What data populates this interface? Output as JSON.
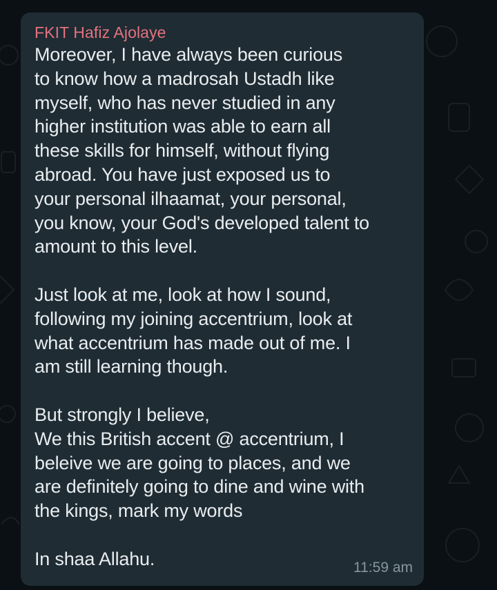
{
  "message": {
    "sender": "FKIT Hafiz Ajolaye",
    "paragraphs": [
      "Moreover, I have always been curious\nto know how a madrosah Ustadh like\nmyself, who has never studied in any\nhigher institution was able to earn all\nthese skills for himself, without flying\nabroad. You have just exposed us to\nyour  personal ilhaamat, your personal,\nyou know, your God's developed talent to\namount to this level.",
      "Just look at me, look at how I sound,\nfollowing my joining accentrium, look at\nwhat accentrium has made out of me. I\nam still learning though.",
      "But strongly I believe,\nWe this British accent @ accentrium, I\nbeleive we are going to places, and we\nare definitely going to dine and wine with\nthe kings, mark my words",
      "In shaa Allahu."
    ],
    "time": "11:59 am"
  },
  "theme": {
    "background": "#0b1014",
    "bubble": "#1f2c34",
    "sender_color": "#e5727e",
    "text_color": "#e9edef",
    "time_color": "#8696a0"
  }
}
